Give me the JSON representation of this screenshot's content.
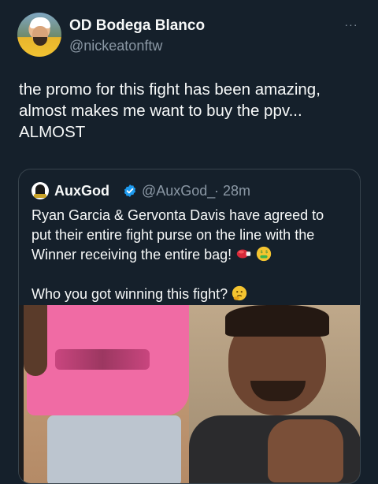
{
  "author": {
    "display_name": "OD Bodega Blanco",
    "handle": "@nickeatonftw"
  },
  "more_label": "···",
  "tweet": {
    "lines": [
      "the promo for this fight has been amazing,",
      "almost makes me want to buy the ppv...",
      "ALMOST"
    ]
  },
  "quoted": {
    "display_name": "AuxGod",
    "handle": "@AuxGod_",
    "separator": "·",
    "time": "28m",
    "verified": true,
    "lines": [
      "Ryan Garcia & Gervonta Davis have agreed to",
      "put their entire fight purse on the line with the",
      "Winner receiving the entire bag!"
    ],
    "question": "Who you got winning this fight?",
    "emojis": [
      "boxing-glove-icon",
      "money-mouth-face-icon",
      "thinking-face-icon"
    ]
  },
  "colors": {
    "background": "#15202b",
    "text": "#f7f9f9",
    "secondary": "#8b98a5",
    "border": "#38444d",
    "verified": "#1d9bf0"
  }
}
